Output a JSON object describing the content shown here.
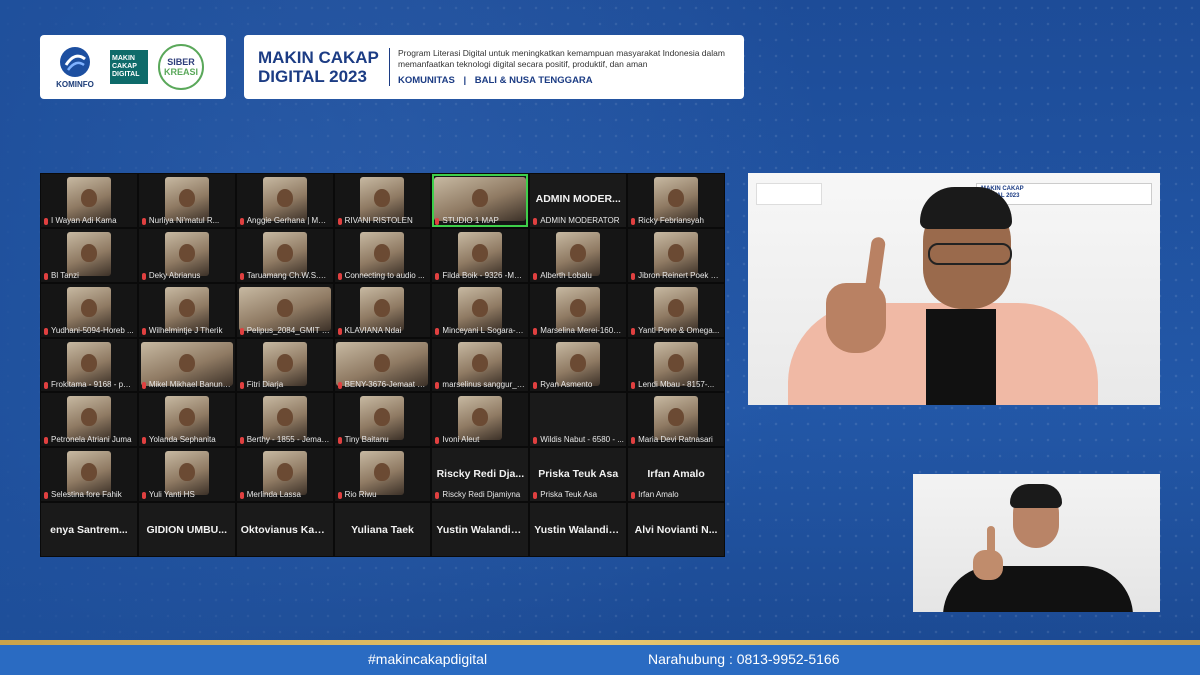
{
  "header": {
    "kominfo_label": "KOMINFO",
    "mcd_logo": [
      "MAKIN",
      "CAKAP",
      "DIGITAL"
    ],
    "siber_logo": [
      "SIBER",
      "KREASI"
    ],
    "title_line1": "MAKIN CAKAP",
    "title_line2": "DIGITAL 2023",
    "description": "Program Literasi Digital untuk meningkatkan kemampuan masyarakat Indonesia dalam memanfaatkan teknologi digital secara positif, produktif, dan aman",
    "sub_left": "KOMUNITAS",
    "sub_sep": "|",
    "sub_right": "BALI & NUSA TENGGARA"
  },
  "participants": [
    {
      "name": "I Wayan Adi Kama",
      "video": true
    },
    {
      "name": "Nurliya Ni'matul R...",
      "video": true
    },
    {
      "name": "Anggie Gerhana | Mol...",
      "video": true
    },
    {
      "name": "RIVANI RISTOLEN",
      "video": true
    },
    {
      "name": "STUDIO 1 MAP",
      "video": true,
      "active": true,
      "wide": true
    },
    {
      "name": "ADMIN MODERATOR",
      "big": "ADMIN  MODER...",
      "video": false
    },
    {
      "name": "Ricky Febriansyah",
      "video": true
    },
    {
      "name": "Bl Tanzi",
      "video": true
    },
    {
      "name": "Deky Abrianus",
      "video": true
    },
    {
      "name": "Taruamang Ch.W.S.S. B...",
      "video": true
    },
    {
      "name": "Connecting to audio ...",
      "video": true
    },
    {
      "name": "Filda Boik - 9326 -Mah...",
      "video": true
    },
    {
      "name": "Alberth Lobalu",
      "video": true
    },
    {
      "name": "Jibron Reinert Poek S...",
      "video": true
    },
    {
      "name": "Yudhani-5094-Horeb ...",
      "video": true
    },
    {
      "name": "Wilhelmintje J Therik",
      "video": true
    },
    {
      "name": "Pelipus_2084_GMIT H...",
      "video": true,
      "wide": true
    },
    {
      "name": "KLAVIANA Ndai",
      "video": true
    },
    {
      "name": "Minceyani L Sogara-6...",
      "video": true
    },
    {
      "name": "Marselina Merei-1608-...",
      "video": true
    },
    {
      "name": "Yanti Pono & Omega...",
      "video": true
    },
    {
      "name": "Frokitama - 9168 - peli...",
      "video": true
    },
    {
      "name": "Mikel Mikhael Banuna...",
      "video": true,
      "wide": true
    },
    {
      "name": "Fitri Diarja",
      "video": true
    },
    {
      "name": "BENY-3676-Jemaat G...",
      "video": true,
      "wide": true
    },
    {
      "name": "marselinus sanggur_7...",
      "video": true
    },
    {
      "name": "Ryan Asmento",
      "video": true
    },
    {
      "name": "Lendi Mbau - 8157-...",
      "video": true
    },
    {
      "name": "Petronela Atriani Juma",
      "video": true
    },
    {
      "name": "Yolanda Sephanita",
      "video": true
    },
    {
      "name": "Berthy - 1855 - Jemaat...",
      "video": true
    },
    {
      "name": "Tiny Baitanu",
      "video": true
    },
    {
      "name": "Ivoni Aleut",
      "video": true
    },
    {
      "name": "Wildis Nabut - 6580 - ...",
      "video": false,
      "noname_big": true
    },
    {
      "name": "Maria Devi Ratnasari",
      "video": true
    },
    {
      "name": "Selestina fore Fahik",
      "video": true
    },
    {
      "name": "Yuli Yanti HS",
      "video": true
    },
    {
      "name": "Merlinda Lassa",
      "video": true
    },
    {
      "name": "Rio Riwu",
      "video": true
    },
    {
      "name": "Riscky Redi Djamiyna",
      "big": "Riscky  Redi  Dja...",
      "video": false
    },
    {
      "name": "Priska Teuk Asa",
      "big": "Priska  Teuk  Asa",
      "video": false
    },
    {
      "name": "Irfan Amalo",
      "big": "Irfan  Amalo",
      "video": false
    },
    {
      "big": "enya  Santrem...",
      "video": false,
      "noname": true
    },
    {
      "big": "GIDION  UMBU...",
      "video": false,
      "noname": true
    },
    {
      "big": "Oktovianus  Kari...",
      "video": false,
      "noname": true
    },
    {
      "big": "Yuliana  Taek",
      "video": false,
      "noname": true
    },
    {
      "big": "Yustin  Walandima",
      "video": false,
      "noname": true
    },
    {
      "big": "Yustin  Walandima",
      "video": false,
      "noname": true
    },
    {
      "big": "Alvi  Novianti  N...",
      "video": false,
      "noname": true
    }
  ],
  "footer": {
    "hashtag": "#makincakapdigital",
    "contact": "Narahubung : 0813-9952-5166"
  },
  "colors": {
    "background": "#1e4f9b",
    "footer_bar": "#2a6bc2",
    "accent_gold": "#c9a24a",
    "brand_navy": "#1c3c84",
    "active_speaker": "#3ecf4a"
  }
}
